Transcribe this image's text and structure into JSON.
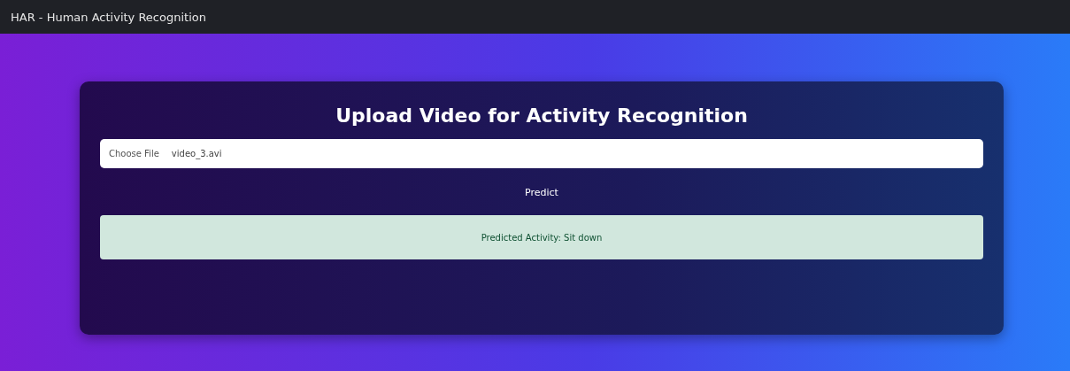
{
  "navbar": {
    "title": "HAR - Human Activity Recognition"
  },
  "card": {
    "heading": "Upload Video for Activity Recognition",
    "file_input": {
      "button": "Choose File",
      "value": "video_3.avi"
    },
    "predict_button": "Predict",
    "result": "Predicted Activity: Sit down"
  }
}
